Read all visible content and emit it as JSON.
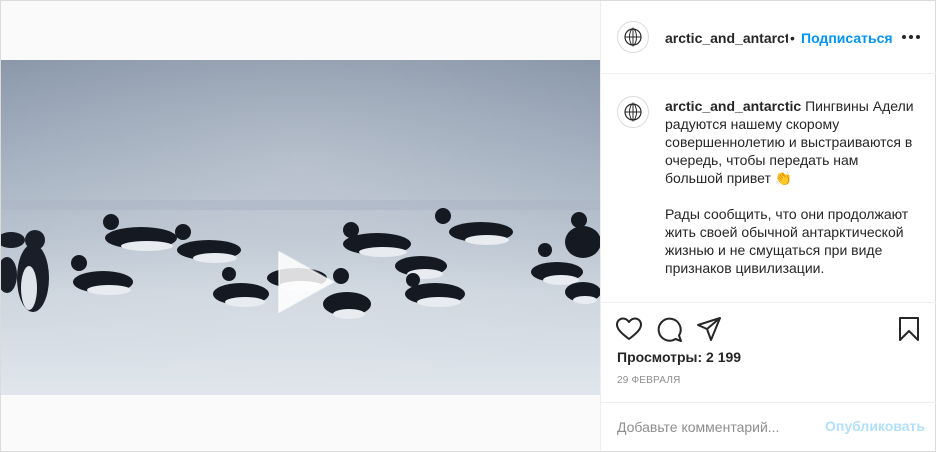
{
  "media": {
    "type": "video",
    "play_icon": "play-icon"
  },
  "header": {
    "avatar_icon": "globe-icon",
    "username": "arctic_and_antarctic",
    "separator": "•",
    "follow_label": "Подписаться",
    "more_icon": "more-options-icon"
  },
  "caption": {
    "username": "arctic_and_antarctic",
    "paragraph1": "Пингвины Адели радуются нашему скорому совершеннолетию и выстраиваются в очередь, чтобы передать нам большой привет 👏",
    "paragraph2": "Рады сообщить, что они продолжают жить своей обычной антарктической жизнью и не смущаться при виде признаков цивилизации."
  },
  "actions": {
    "icons": [
      "heart-icon",
      "comment-icon",
      "share-icon",
      "bookmark-icon"
    ]
  },
  "views_text": "Просмотры: 2 199",
  "date_text": "29 ФЕВРАЛЯ",
  "comment": {
    "placeholder": "Добавьте комментарий...",
    "publish_label": "Опубликовать"
  },
  "colors": {
    "accent": "#0095f6",
    "publish_disabled": "#b2dffc",
    "text": "#262626",
    "muted": "#8e8e8e",
    "border": "#dbdbdb"
  }
}
